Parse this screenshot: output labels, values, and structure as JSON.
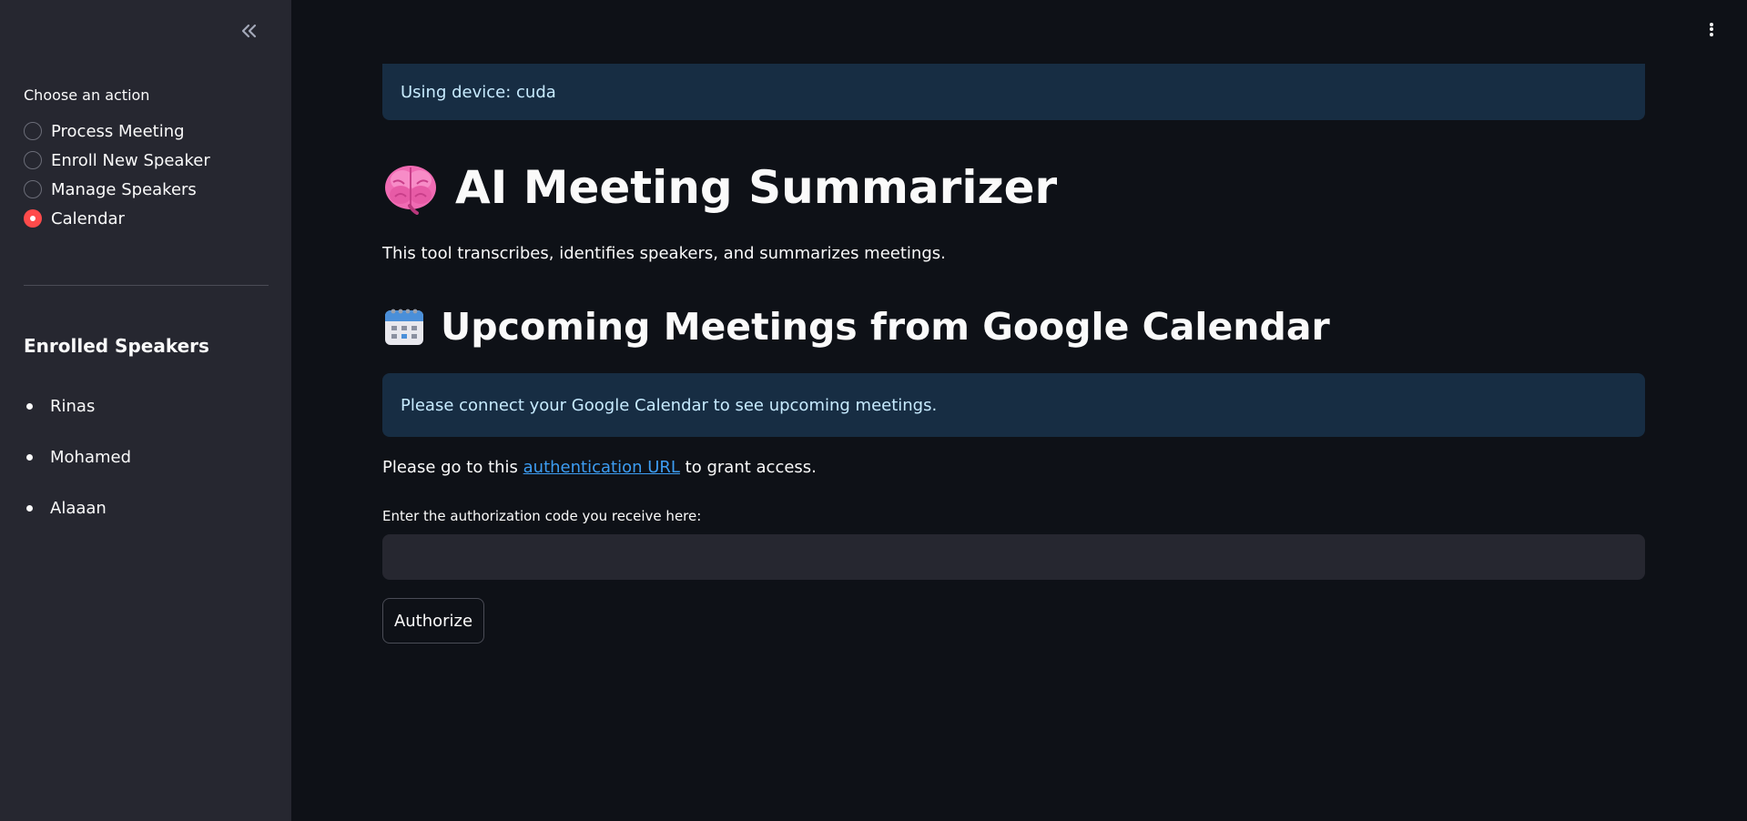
{
  "sidebar": {
    "collapse_icon": "double-chevron-left-icon",
    "action_label": "Choose an action",
    "actions": [
      {
        "label": "Process Meeting",
        "selected": false
      },
      {
        "label": "Enroll New Speaker",
        "selected": false
      },
      {
        "label": "Manage Speakers",
        "selected": false
      },
      {
        "label": "Calendar",
        "selected": true
      }
    ],
    "enrolled_title": "Enrolled Speakers",
    "speakers": [
      "Rinas",
      "Mohamed",
      "Alaaan"
    ]
  },
  "header": {
    "menu_icon": "kebab-menu-icon"
  },
  "main": {
    "device_info": "Using device: cuda",
    "title": "AI Meeting Summarizer",
    "title_icon": "brain-icon",
    "description": "This tool transcribes, identifies speakers, and summarizes meetings.",
    "calendar_heading": "Upcoming Meetings from Google Calendar",
    "calendar_icon": "calendar-icon",
    "calendar_info": "Please connect your Google Calendar to see upcoming meetings.",
    "auth_prefix": "Please go to this ",
    "auth_link": "authentication URL",
    "auth_suffix": " to grant access.",
    "code_label": "Enter the authorization code you receive here:",
    "code_value": "",
    "authorize_button": "Authorize"
  },
  "colors": {
    "background": "#0e1117",
    "sidebar": "#262730",
    "accent": "#ff4b4b",
    "info_bg": "#172d43",
    "info_text": "#c7ebff",
    "link": "#3d9df3"
  }
}
